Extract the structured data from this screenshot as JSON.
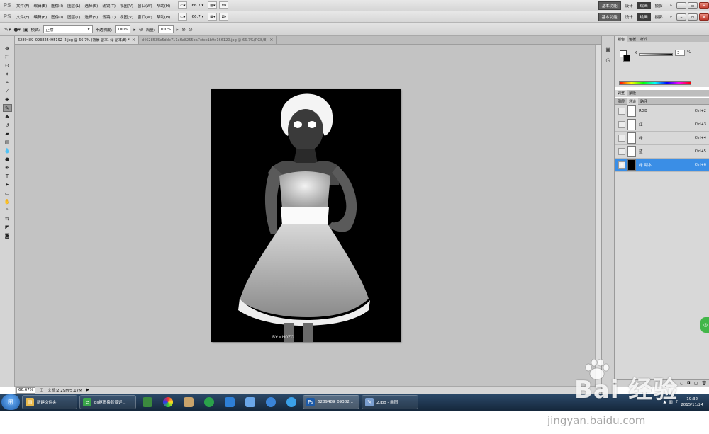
{
  "app": {
    "logo": "PS",
    "menus": [
      "文件(F)",
      "编辑(E)",
      "图像(I)",
      "图层(L)",
      "选择(S)",
      "滤镜(T)",
      "视图(V)",
      "窗口(W)",
      "帮助(H)"
    ],
    "zoom_display": "66.7",
    "workspaces": [
      "基本功能",
      "设计",
      "绘画",
      "摄影"
    ],
    "workspace_more": "»"
  },
  "options_bar": {
    "mode_label": "模式:",
    "mode_value": "正常",
    "opacity_label": "不透明度:",
    "opacity_value": "100%",
    "flow_label": "流量:",
    "flow_value": "100%"
  },
  "tabs": [
    {
      "label": "6289489_093825495192_2.jpg @ 66.7% (背景 副本, 绿 副本/8) *"
    },
    {
      "label": "d4628535e5dde711a6a8255ba7efce1b9d166120.jpg @ 66.7%(RGB/8)"
    }
  ],
  "document": {
    "watermark_text": "BY:=H0ZO"
  },
  "status": {
    "zoom": "66.67%",
    "doc_info": "文档:2.29M/5.17M"
  },
  "color_panel": {
    "tabs": [
      "颜色",
      "色板",
      "样式"
    ],
    "channel_label": "K",
    "channel_value": "3",
    "unit": "%"
  },
  "adjust_panel": {
    "tabs": [
      "调整",
      "蒙版"
    ]
  },
  "channels_panel": {
    "tabs": [
      "图层",
      "通道",
      "路径"
    ],
    "rows": [
      {
        "name": "RGB",
        "shortcut": "Ctrl+2",
        "selected": false
      },
      {
        "name": "红",
        "shortcut": "Ctrl+3",
        "selected": false
      },
      {
        "name": "绿",
        "shortcut": "Ctrl+4",
        "selected": false
      },
      {
        "name": "蓝",
        "shortcut": "Ctrl+5",
        "selected": false
      },
      {
        "name": "绿 副本",
        "shortcut": "Ctrl+6",
        "selected": true
      }
    ]
  },
  "taskbar": {
    "tasks": [
      {
        "label": "新建文件夹",
        "color": "#e8b84a"
      },
      {
        "label": "ps抠图换背景详...",
        "color": "#3aa64a"
      },
      {
        "label": "6289489_09382...",
        "color": "#1c5aa8"
      },
      {
        "label": "2.jpg - 画图",
        "color": "#7a9ecf"
      }
    ],
    "time": "19:32",
    "date": "2015/11/24"
  },
  "brand_watermark": {
    "text": "Bai  经验",
    "url": "jingyan.baidu.com"
  },
  "colors": {
    "selection_blue": "#3a8ee6",
    "canvas_gray": "#c3c3c3",
    "taskbar_dark": "#15273b"
  }
}
